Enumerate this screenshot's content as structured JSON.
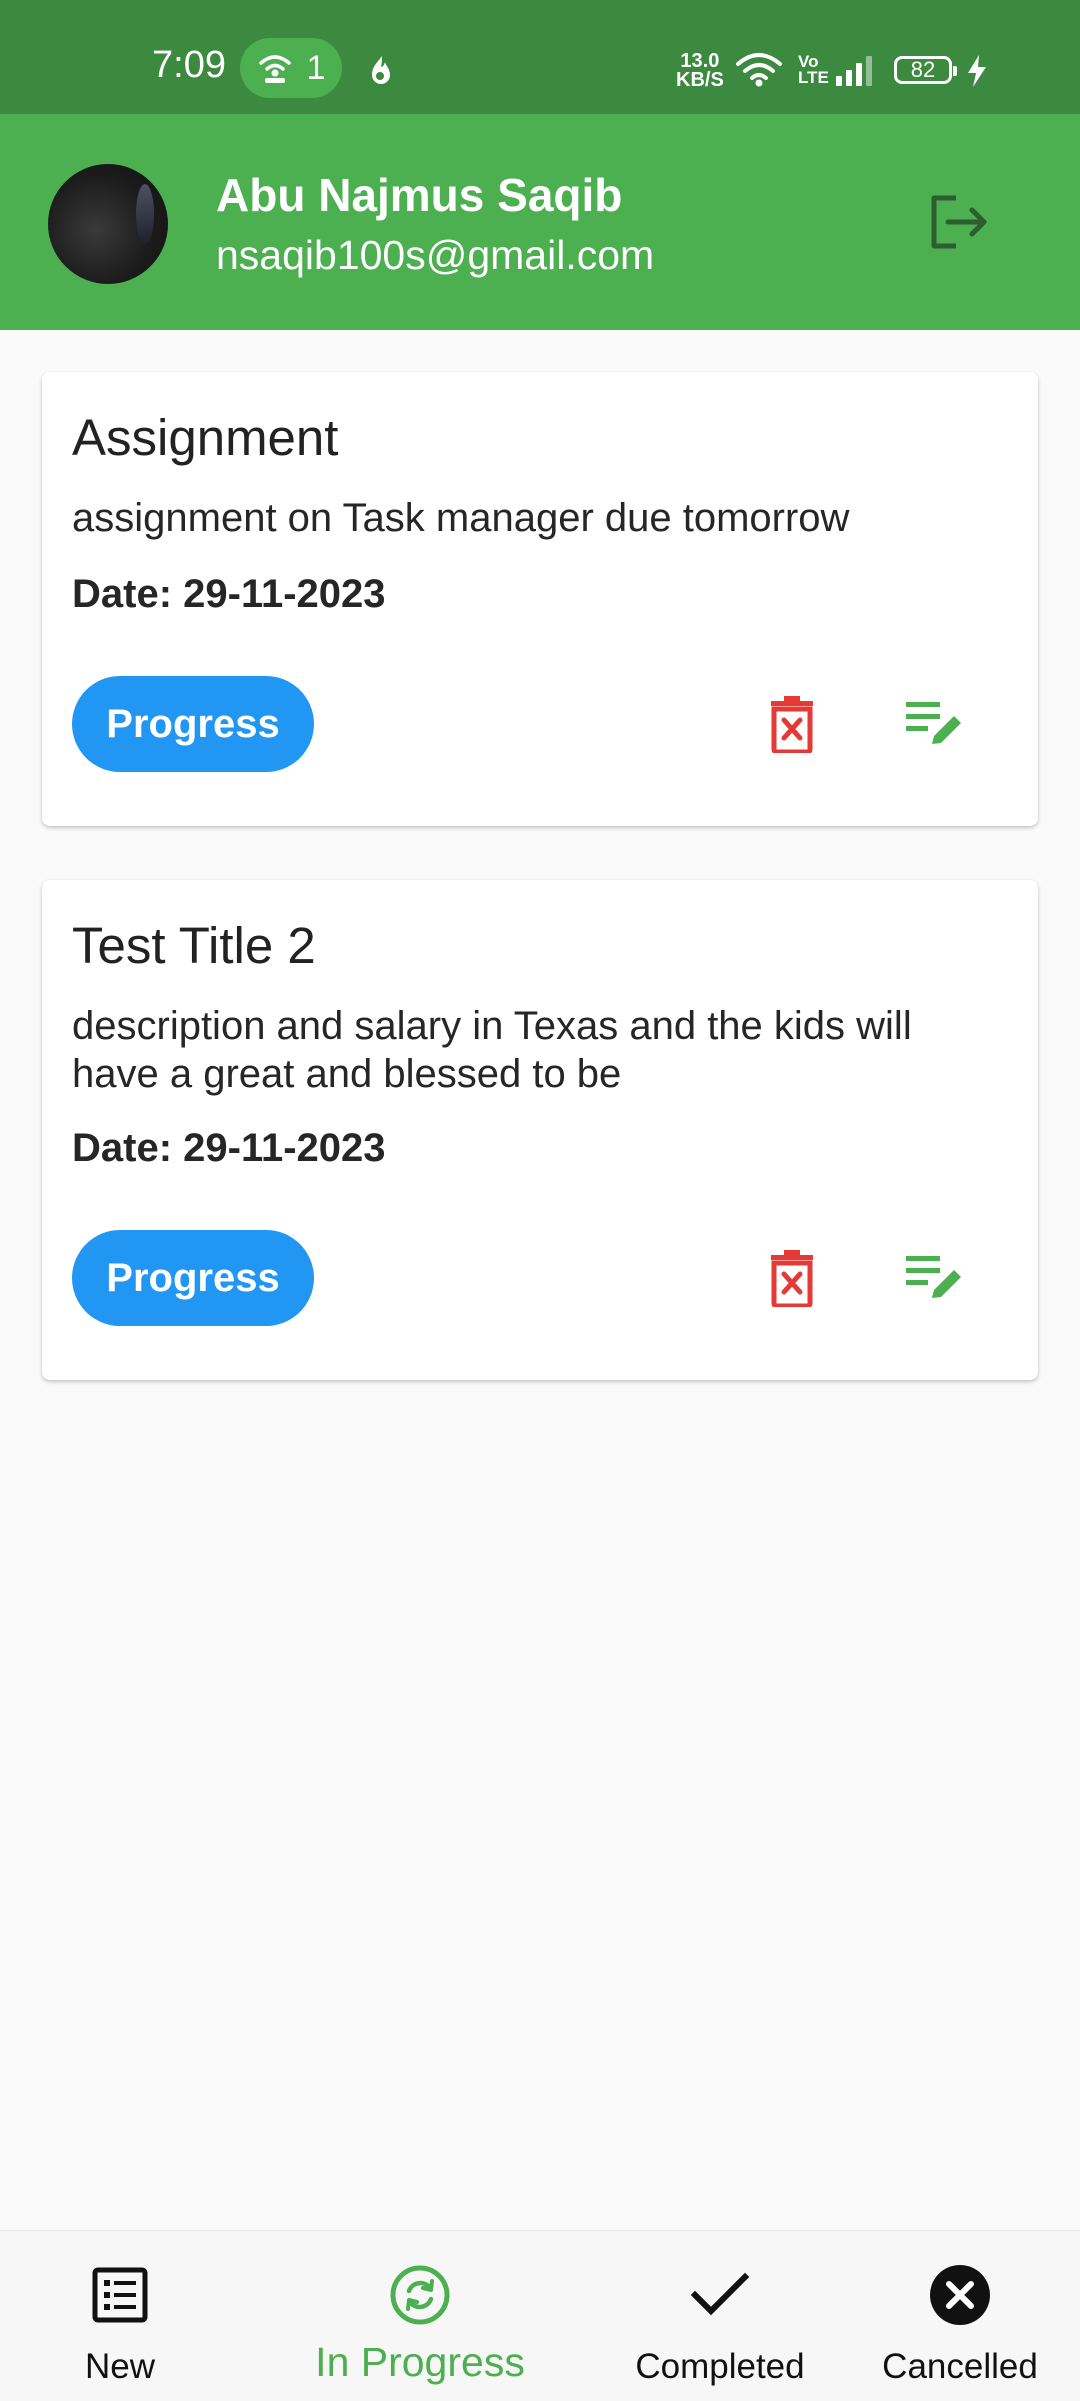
{
  "status_bar": {
    "time": "7:09",
    "hotspot_count": "1",
    "net_speed_value": "13.0",
    "net_speed_unit": "KB/S",
    "volte_top": "Vo",
    "volte_bottom": "LTE",
    "battery": "82"
  },
  "header": {
    "name": "Abu Najmus Saqib",
    "email": "nsaqib100s@gmail.com",
    "logout_icon": "logout-icon",
    "accent_color": "#4caf50"
  },
  "tasks": [
    {
      "title": "Assignment",
      "description": "assignment on Task manager due tomorrow",
      "date": "Date: 29-11-2023",
      "status": "Progress"
    },
    {
      "title": "Test Title 2",
      "description": "description and salary in Texas and the kids will have a great and blessed to be",
      "date": "Date: 29-11-2023",
      "status": "Progress"
    }
  ],
  "colors": {
    "chip": "#2196f3",
    "delete": "#e53935",
    "edit": "#4caf50"
  },
  "bottom_nav": {
    "items": [
      {
        "label": "New",
        "icon": "list-icon"
      },
      {
        "label": "In Progress",
        "icon": "sync-icon",
        "selected": true
      },
      {
        "label": "Completed",
        "icon": "check-icon"
      },
      {
        "label": "Cancelled",
        "icon": "cancel-icon"
      }
    ]
  }
}
